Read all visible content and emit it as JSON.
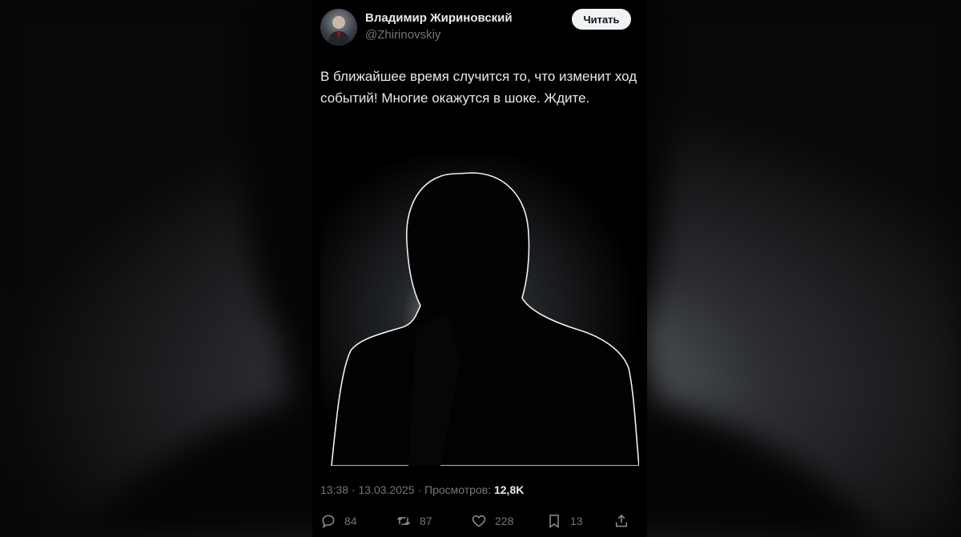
{
  "tweet": {
    "author": {
      "display_name": "Владимир Жириновский",
      "handle": "@Zhirinovskiy"
    },
    "follow_label": "Читать",
    "text": "В ближайшее время случится то, что изменит ход событий! Многие окажутся в шоке. Ждите.",
    "time": "13:38",
    "date": "13.03.2025",
    "views_label": "Просмотров:",
    "views_count": "12,8K",
    "actions": {
      "replies": "84",
      "reposts": "87",
      "likes": "228",
      "bookmarks": "13"
    }
  },
  "icons": {
    "reply": "reply-icon",
    "repost": "repost-icon",
    "like": "heart-icon",
    "bookmark": "bookmark-icon",
    "share": "share-icon"
  },
  "colors": {
    "background": "#000000",
    "text_primary": "#e7e9ea",
    "text_secondary": "#71767b",
    "follow_button": "#eff3f4"
  }
}
